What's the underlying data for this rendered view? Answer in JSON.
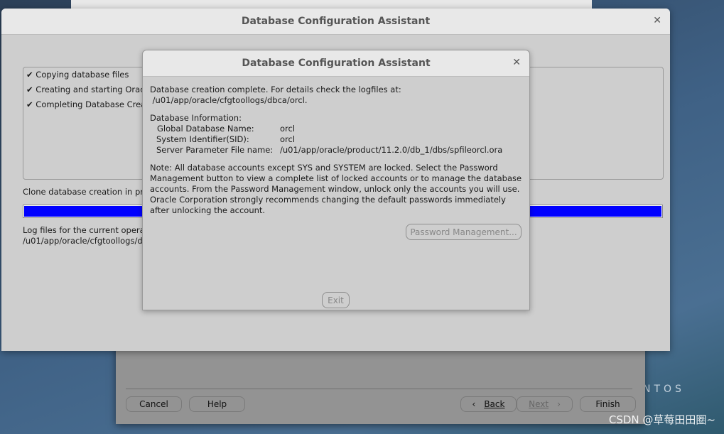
{
  "window_title": "Database Configuration Assistant",
  "steps": [
    "✔ Copying database files",
    "✔ Creating and starting Oracle Instance",
    "✔ Completing Database Creation"
  ],
  "status_text": "Clone database creation in progress",
  "progress_percent": 100,
  "progress_color": "#0000ff",
  "log_label": "Log files for the current operation are located at:",
  "log_path": "/u01/app/oracle/cfgtoollogs/dbca/orcl",
  "dialog": {
    "title": "Database Configuration Assistant",
    "line1": "Database creation complete. For details check the logfiles at:",
    "line2": " /u01/app/oracle/cfgtoollogs/dbca/orcl.",
    "info_header": "Database Information:",
    "info": [
      {
        "label": "Global Database Name:",
        "value": "orcl"
      },
      {
        "label": "System Identifier(SID):",
        "value": "orcl"
      },
      {
        "label": "Server Parameter File name:",
        "value": "/u01/app/oracle/product/11.2.0/db_1/dbs/spfileorcl.ora"
      }
    ],
    "note": [
      "Note: All database accounts except SYS and SYSTEM are locked. Select the Password",
      "Management button to view a complete list of locked accounts or to manage the database",
      "accounts. From the Password Management window, unlock only the accounts you will use.",
      "Oracle Corporation strongly recommends changing the default passwords immediately",
      "after unlocking the account."
    ],
    "password_button": "Password Management...",
    "exit_button": "Exit"
  },
  "wizard": {
    "cancel": "Cancel",
    "help": "Help",
    "back": "Back",
    "next": "Next",
    "finish": "Finish"
  },
  "desktop": {
    "brand": "NTOS",
    "watermark": "CSDN @草莓田田圈~"
  }
}
